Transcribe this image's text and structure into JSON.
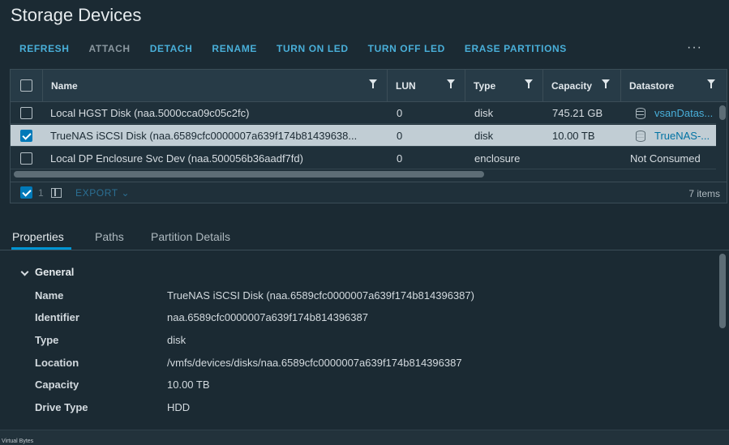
{
  "page_title": "Storage Devices",
  "toolbar": {
    "refresh": "REFRESH",
    "attach": "ATTACH",
    "detach": "DETACH",
    "rename": "RENAME",
    "turn_on_led": "TURN ON LED",
    "turn_off_led": "TURN OFF LED",
    "erase_partitions": "ERASE PARTITIONS",
    "more": "···"
  },
  "grid": {
    "columns": [
      "Name",
      "LUN",
      "Type",
      "Capacity",
      "Datastore"
    ],
    "rows": [
      {
        "name": "Local HGST Disk (naa.5000cca09c05c2fc)",
        "lun": "0",
        "type": "disk",
        "capacity": "745.21 GB",
        "datastore": "vsanDatas...",
        "checked": false,
        "selected": false
      },
      {
        "name": "TrueNAS iSCSI Disk (naa.6589cfc0000007a639f174b81439638...",
        "lun": "0",
        "type": "disk",
        "capacity": "10.00 TB",
        "datastore": "TrueNAS-...",
        "checked": true,
        "selected": true
      },
      {
        "name": "Local DP Enclosure Svc Dev (naa.500056b36aadf7fd)",
        "lun": "0",
        "type": "enclosure",
        "capacity": "",
        "datastore": "Not Consumed",
        "checked": false,
        "selected": false
      }
    ],
    "selected_count": "1",
    "export_label": "EXPORT",
    "item_count": "7 items"
  },
  "tabs": [
    "Properties",
    "Paths",
    "Partition Details"
  ],
  "properties": {
    "section_title": "General",
    "items": [
      {
        "label": "Name",
        "value": "TrueNAS iSCSI Disk (naa.6589cfc0000007a639f174b814396387)"
      },
      {
        "label": "Identifier",
        "value": "naa.6589cfc0000007a639f174b814396387"
      },
      {
        "label": "Type",
        "value": "disk"
      },
      {
        "label": "Location",
        "value": "/vmfs/devices/disks/naa.6589cfc0000007a639f174b814396387"
      },
      {
        "label": "Capacity",
        "value": "10.00 TB"
      },
      {
        "label": "Drive Type",
        "value": "HDD"
      }
    ]
  },
  "status_bar": {
    "text": "Virtual Bytes"
  },
  "colors": {
    "accent": "#49afd9",
    "background": "#1b2a33",
    "selected_row": "#c1cdd4"
  }
}
